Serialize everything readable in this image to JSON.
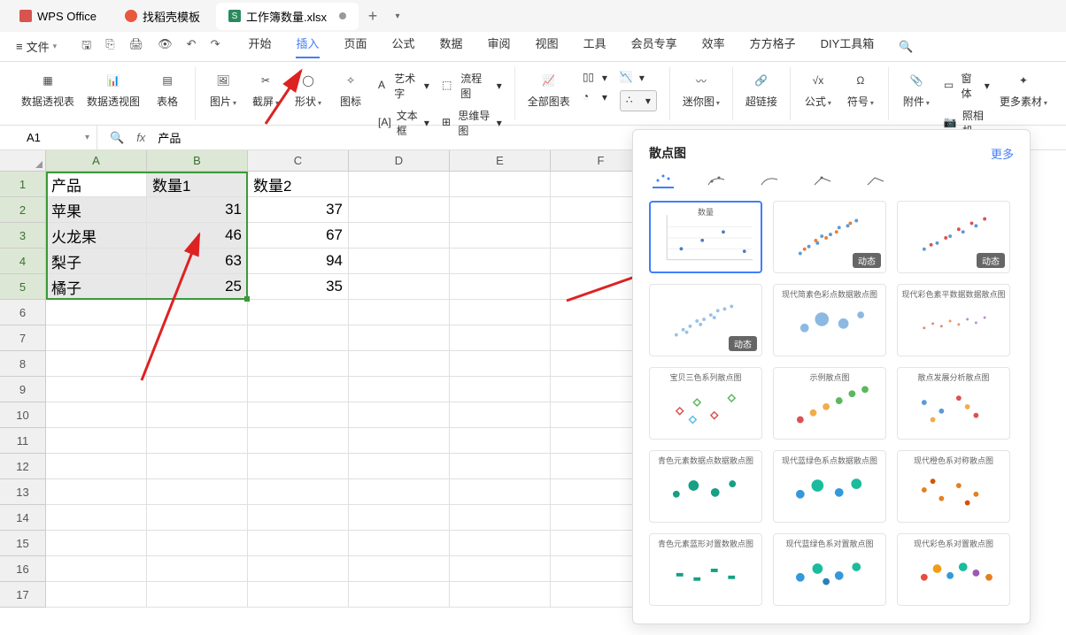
{
  "tabs": {
    "wps": "WPS Office",
    "tmpl": "找稻壳模板",
    "doc": "工作簿数量.xlsx",
    "doc_badge": "S"
  },
  "menu": {
    "file": "文件",
    "main": [
      "开始",
      "插入",
      "页面",
      "公式",
      "数据",
      "审阅",
      "视图",
      "工具",
      "会员专享",
      "效率",
      "方方格子",
      "DIY工具箱"
    ],
    "active_index": 1
  },
  "ribbon": {
    "pivot_table": "数据透视表",
    "pivot_chart": "数据透视图",
    "table": "表格",
    "picture": "图片",
    "screenshot": "截屏",
    "shape": "形状",
    "icon": "图标",
    "wordart": "艺术字",
    "textbox": "文本框",
    "flowchart": "流程图",
    "mindmap": "思维导图",
    "all_charts": "全部图表",
    "sparkline": "迷你图",
    "hyperlink": "超链接",
    "formula": "公式",
    "symbol": "符号",
    "attachment": "附件",
    "window": "窗体",
    "camera": "照相机",
    "more": "更多素材"
  },
  "namebox": {
    "ref": "A1"
  },
  "formula": {
    "content": "产品"
  },
  "columns": [
    "A",
    "B",
    "C",
    "D",
    "E",
    "F"
  ],
  "rows": [
    1,
    2,
    3,
    4,
    5,
    6,
    7,
    8,
    9,
    10,
    11,
    12,
    13,
    14,
    15,
    16,
    17
  ],
  "data": {
    "headers": [
      "产品",
      "数量1",
      "数量2"
    ],
    "rows": [
      [
        "苹果",
        "31",
        "37"
      ],
      [
        "火龙果",
        "46",
        "67"
      ],
      [
        "梨子",
        "63",
        "94"
      ],
      [
        "橘子",
        "25",
        "35"
      ]
    ]
  },
  "popup": {
    "title": "散点图",
    "more": "更多",
    "dynamic": "动态",
    "thumb_titles": [
      "数量",
      "",
      "",
      "",
      "现代简素色彩点数据散点图",
      "现代彩色素平数据数据散点图",
      "宝贝三色系列散点图",
      "示例散点图",
      "散点发展分析散点图",
      "青色元素数据点数据散点图",
      "现代蓝绿色系点数据散点图",
      "现代橙色系对称散点图",
      "青色元素蓝形对置数散点图",
      "现代蓝绿色系对置散点图",
      "现代彩色系对置散点图"
    ]
  },
  "chart_data": {
    "type": "scatter",
    "title": "数量",
    "series": [
      {
        "name": "数量1",
        "values": [
          31,
          46,
          63,
          25
        ]
      },
      {
        "name": "数量2",
        "values": [
          37,
          67,
          94,
          35
        ]
      }
    ],
    "categories": [
      "苹果",
      "火龙果",
      "梨子",
      "橘子"
    ]
  }
}
